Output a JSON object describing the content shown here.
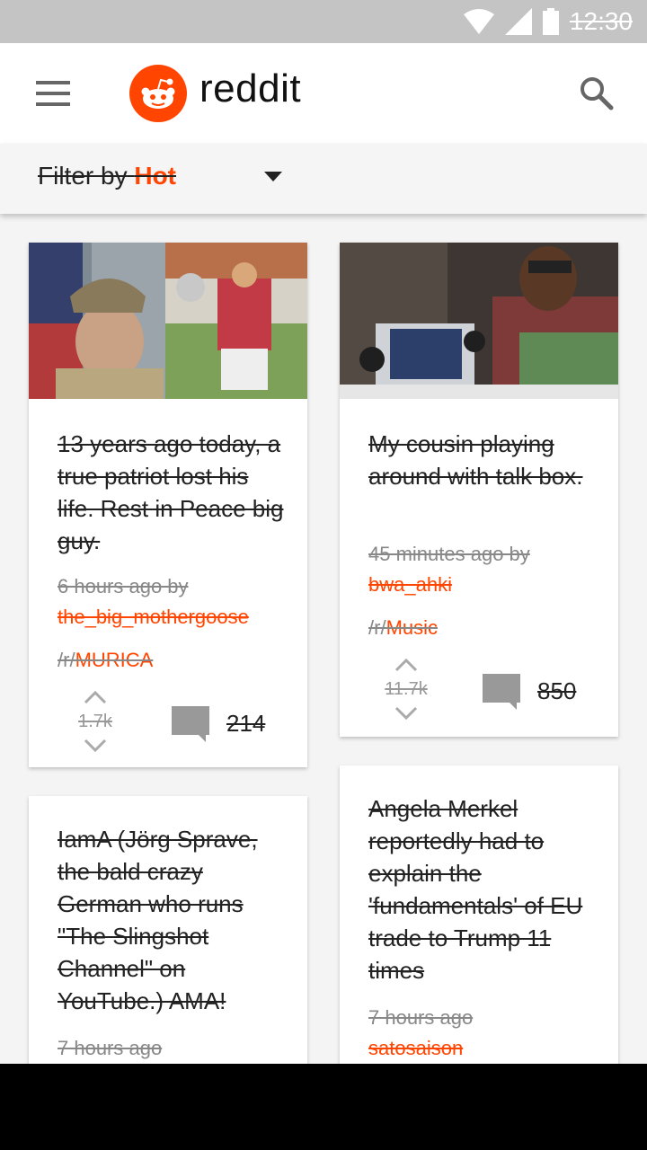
{
  "status_bar": {
    "time": "12:30"
  },
  "app_bar": {
    "brand": "reddit"
  },
  "filter": {
    "prefix": "Filter by",
    "value": "Hot"
  },
  "colors": {
    "accent": "#ff4500",
    "status_bar": "#c4c4c4",
    "text": "#222222",
    "muted": "#888888"
  },
  "posts": [
    {
      "title": "13 years ago today, a true patriot lost his life. Rest in Peace big guy.",
      "time": "6 hours ago by",
      "author": "the_big_mothergoose",
      "sub_prefix": "/r/",
      "subreddit": "MURICA",
      "votes": "1.7k",
      "comments": "214"
    },
    {
      "title": "My cousin playing around with talk box.",
      "time": "45 minutes ago by",
      "author": "bwa_ahki",
      "sub_prefix": "/r/",
      "subreddit": "Music",
      "votes": "11.7k",
      "comments": "850"
    },
    {
      "title": "IamA (Jörg Sprave, the bald crazy German who runs \"The Slingshot Channel\" on YouTube.) AMA!",
      "time": "7 hours ago"
    },
    {
      "title": "Angela Merkel reportedly had to explain the 'fundamentals' of EU trade to Trump 11 times",
      "time": "7 hours ago",
      "author": "satosaison"
    }
  ]
}
